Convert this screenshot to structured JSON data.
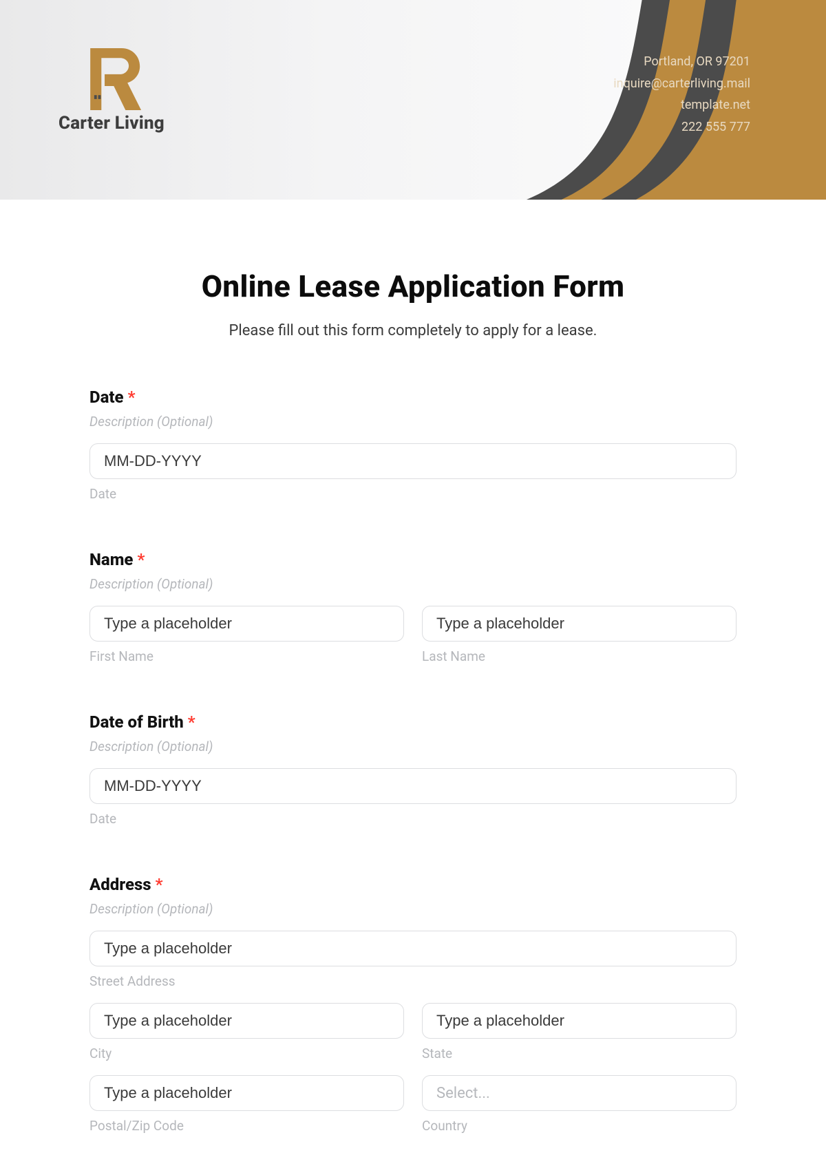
{
  "brand": {
    "name": "Carter Living"
  },
  "contact": {
    "line1": "Portland, OR 97201",
    "line2": "inquire@carterliving.mail",
    "line3": "template.net",
    "line4": "222 555 777"
  },
  "form": {
    "title": "Online Lease Application Form",
    "subtitle": "Please fill out this form completely to apply for a lease.",
    "required_mark": "*",
    "desc_placeholder": "Description (Optional)",
    "common": {
      "text_placeholder": "Type a placeholder",
      "date_placeholder": "MM-DD-YYYY",
      "select_placeholder": "Select..."
    },
    "fields": {
      "date": {
        "label": "Date",
        "sub": "Date"
      },
      "name": {
        "label": "Name",
        "first_sub": "First Name",
        "last_sub": "Last Name"
      },
      "dob": {
        "label": "Date of Birth",
        "sub": "Date"
      },
      "address": {
        "label": "Address",
        "street_sub": "Street Address",
        "city_sub": "City",
        "state_sub": "State",
        "postal_sub": "Postal/Zip Code",
        "country_sub": "Country"
      }
    }
  }
}
